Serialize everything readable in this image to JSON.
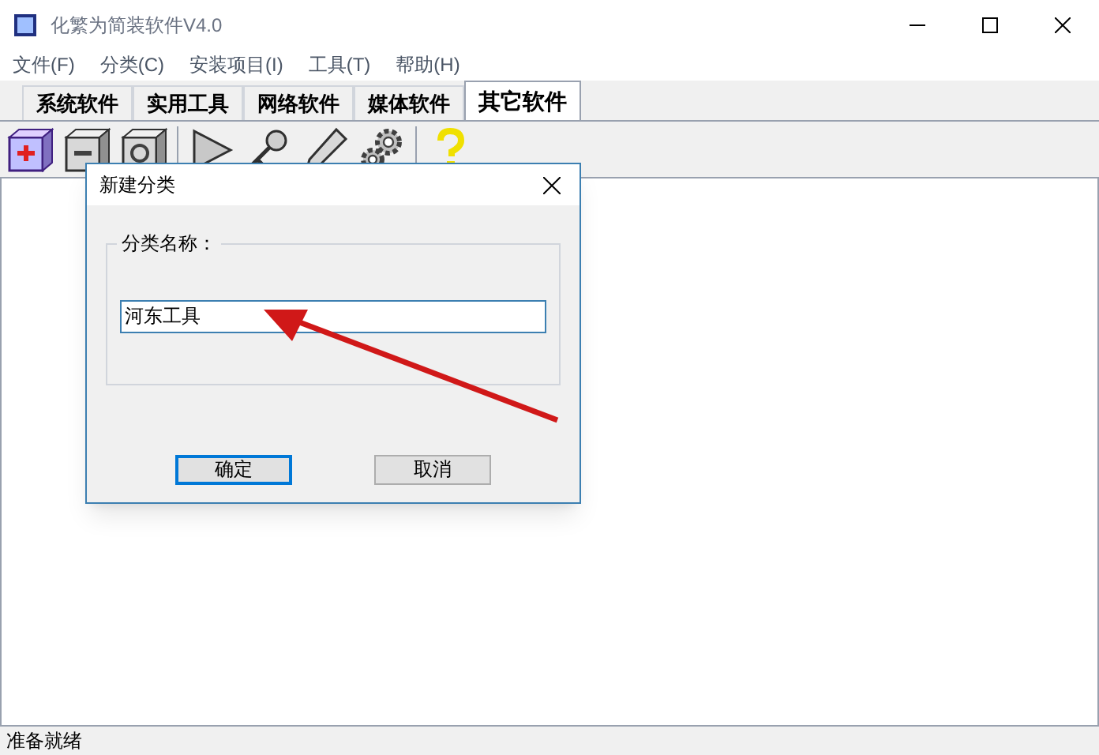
{
  "window": {
    "title": "化繁为简装软件V4.0"
  },
  "menu": [
    "文件(F)",
    "分类(C)",
    "安装项目(I)",
    "工具(T)",
    "帮助(H)"
  ],
  "tabs": [
    {
      "label": "系统软件",
      "selected": false
    },
    {
      "label": "实用工具",
      "selected": false
    },
    {
      "label": "网络软件",
      "selected": false
    },
    {
      "label": "媒体软件",
      "selected": false
    },
    {
      "label": "其它软件",
      "selected": true
    }
  ],
  "toolbar": [
    {
      "kind": "add"
    },
    {
      "kind": "remove"
    },
    {
      "kind": "view"
    },
    {
      "kind": "play"
    },
    {
      "kind": "key"
    },
    {
      "kind": "pen"
    },
    {
      "kind": "gears"
    },
    {
      "kind": "help"
    }
  ],
  "dialog": {
    "title": "新建分类",
    "group_label": "分类名称：",
    "name_value": "河东工具",
    "buttons": [
      {
        "label": "确定",
        "default": true
      },
      {
        "label": "取消",
        "default": false
      }
    ]
  },
  "status_bar": "准备就绪"
}
